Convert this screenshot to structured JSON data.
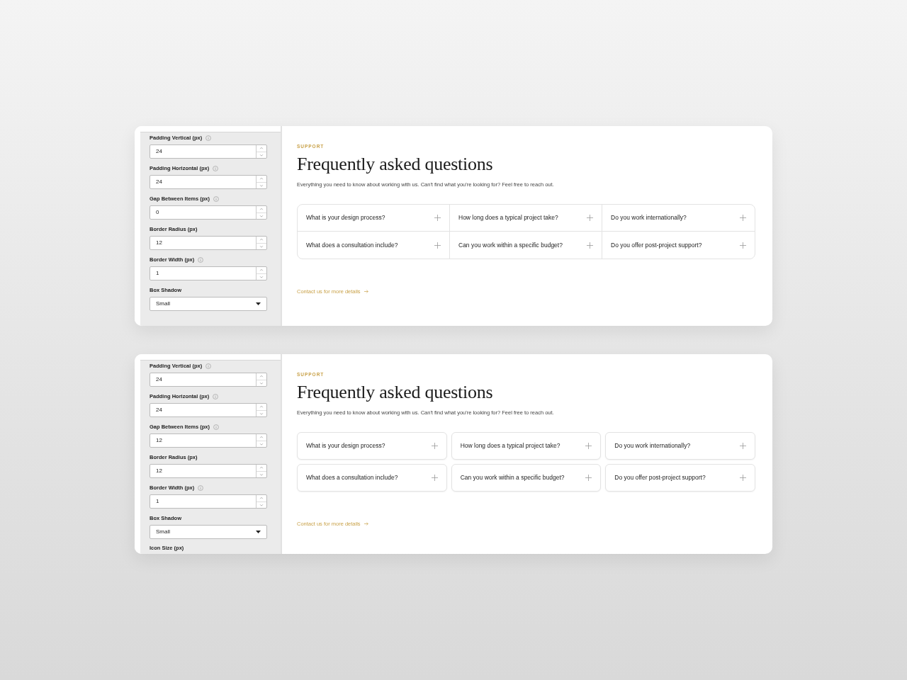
{
  "panels": [
    {
      "settings": [
        {
          "kind": "number",
          "label": "Padding Vertical (px)",
          "info": true,
          "value": "24"
        },
        {
          "kind": "number",
          "label": "Padding Horizontal (px)",
          "info": true,
          "value": "24"
        },
        {
          "kind": "number",
          "label": "Gap Between Items (px)",
          "info": true,
          "value": "0"
        },
        {
          "kind": "number",
          "label": "Border Radius (px)",
          "info": false,
          "value": "12"
        },
        {
          "kind": "number",
          "label": "Border Width (px)",
          "info": true,
          "value": "1"
        },
        {
          "kind": "select",
          "label": "Box Shadow",
          "info": false,
          "value": "Small"
        }
      ],
      "preview": {
        "eyebrow": "SUPPORT",
        "title": "Frequently asked questions",
        "subtitle": "Everything you need to know about working with us. Can't find what you're looking for? Feel free to reach out.",
        "kind": "joined",
        "questions": [
          "What is your design process?",
          "How long does a typical project take?",
          "Do you work internationally?",
          "What does a consultation include?",
          "Can you work within a specific budget?",
          "Do you offer post-project support?"
        ],
        "link": "Contact us for more details"
      }
    },
    {
      "settings": [
        {
          "kind": "number",
          "label": "Padding Vertical (px)",
          "info": true,
          "value": "24"
        },
        {
          "kind": "number",
          "label": "Padding Horizontal (px)",
          "info": true,
          "value": "24"
        },
        {
          "kind": "number",
          "label": "Gap Between Items (px)",
          "info": true,
          "value": "12"
        },
        {
          "kind": "number",
          "label": "Border Radius (px)",
          "info": false,
          "value": "12"
        },
        {
          "kind": "number",
          "label": "Border Width (px)",
          "info": true,
          "value": "1"
        },
        {
          "kind": "select",
          "label": "Box Shadow",
          "info": false,
          "value": "Small"
        },
        {
          "kind": "heading",
          "label": "Icon Size (px)",
          "info": false
        }
      ],
      "preview": {
        "eyebrow": "SUPPORT",
        "title": "Frequently asked questions",
        "subtitle": "Everything you need to know about working with us. Can't find what you're looking for? Feel free to reach out.",
        "kind": "separate",
        "questions": [
          "What is your design process?",
          "How long does a typical project take?",
          "Do you work internationally?",
          "What does a consultation include?",
          "Can you work within a specific budget?",
          "Do you offer post-project support?"
        ],
        "link": "Contact us for more details"
      }
    }
  ]
}
